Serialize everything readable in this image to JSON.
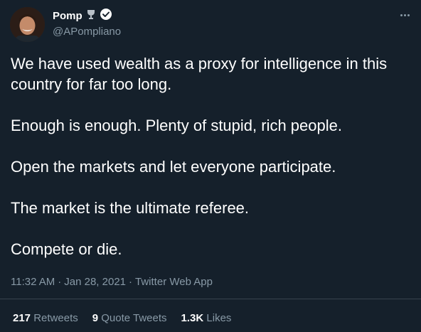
{
  "author": {
    "display_name": "Pomp",
    "handle": "@APompliano",
    "badge_icons": [
      "trophy-icon",
      "verified-badge-icon"
    ]
  },
  "tweet": {
    "paragraphs": [
      "We have used wealth as a proxy for intelligence in this country for far too long.",
      "Enough is enough. Plenty of stupid, rich people.",
      "Open the markets and let everyone participate.",
      "The market is the ultimate referee.",
      "Compete or die."
    ],
    "time": "11:32 AM",
    "date": "Jan 28, 2021",
    "source": "Twitter Web App",
    "separator": "·"
  },
  "stats": {
    "retweets": {
      "count": "217",
      "label": "Retweets"
    },
    "quote_tweets": {
      "count": "9",
      "label": "Quote Tweets"
    },
    "likes": {
      "count": "1.3K",
      "label": "Likes"
    }
  },
  "colors": {
    "background": "#15202b",
    "text_primary": "#ffffff",
    "text_secondary": "#8899a6",
    "divider": "#38444d"
  }
}
